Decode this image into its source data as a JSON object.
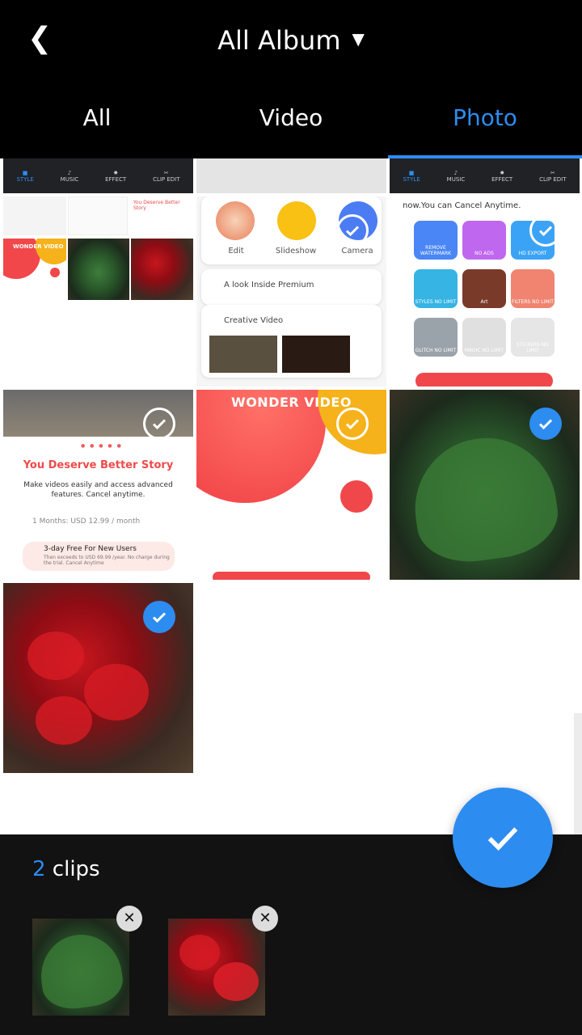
{
  "header": {
    "back_icon": "chevron-left-icon",
    "title": "All Album",
    "caret": "▼"
  },
  "tabs": [
    {
      "label": "All",
      "active": false
    },
    {
      "label": "Video",
      "active": false
    },
    {
      "label": "Photo",
      "active": true
    }
  ],
  "grid": {
    "tile_promo": {
      "edit": "Edit",
      "slideshow": "Slideshow",
      "camera": "Camera",
      "premium": "A look Inside Premium",
      "creative": "Creative Video"
    },
    "tile_premium": {
      "heading": "now.You can Cancel Anytime.",
      "items": [
        "REMOVE WATERMARK",
        "NO ADS",
        "HD EXPORT",
        "STYLES NO LIMIT",
        "Art",
        "FILTERS NO LIMIT",
        "GLITCH NO LIMIT",
        "MAGIC NO LIMIT",
        "STICKERS NO LIMIT"
      ]
    },
    "tile_story": {
      "title": "You Deserve Better Story",
      "subtitle": "Make videos easily and access advanced features. Cancel anytime.",
      "plan": "1 Months: USD 12.99 / month",
      "trial_title": "3-day Free For New Users",
      "trial_detail": "Then exceeds to USD 69.99 /year. No charge during the trial. Cancel Anytime"
    },
    "tile_wonder": {
      "title": "WONDER VIDEO"
    }
  },
  "selection": {
    "count": "2",
    "clips_word": " clips"
  },
  "colors": {
    "accent": "#2d8cf0",
    "header_bg": "#000000",
    "panel_bg": "#121212"
  }
}
